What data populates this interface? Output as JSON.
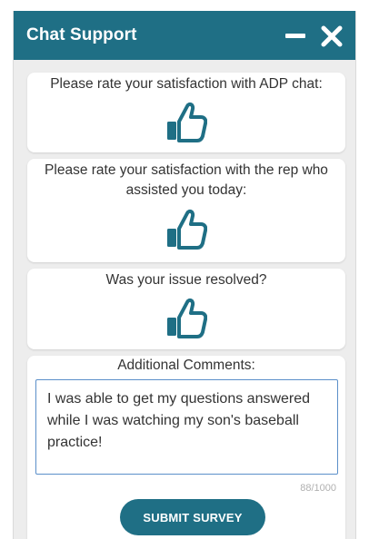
{
  "header": {
    "title": "Chat Support",
    "minimize_icon": "minimize-icon",
    "close_icon": "close-icon",
    "color": "#1f6f85"
  },
  "questions": [
    {
      "text": "Please rate your satisfaction with ADP chat:",
      "icon": "thumbs-up-icon"
    },
    {
      "text": "Please rate your satisfaction with the rep who assisted you today:",
      "icon": "thumbs-up-icon"
    },
    {
      "text": "Was your issue resolved?",
      "icon": "thumbs-up-icon"
    }
  ],
  "comments": {
    "label": "Additional Comments:",
    "value": "I was able to get my questions answered while I was watching my son's baseball practice!",
    "counter": "88/1000"
  },
  "submit_label": "SUBMIT SURVEY"
}
